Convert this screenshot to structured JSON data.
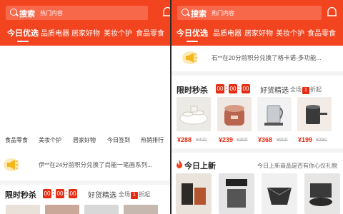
{
  "header": {
    "search_label": "搜索",
    "search_hint": "热门内容",
    "tabs": [
      "今日优选",
      "品质电器",
      "居家好物",
      "美妆个护",
      "食品零食"
    ]
  },
  "left": {
    "categories": [
      "食品零食",
      "美妆个护",
      "居家好物",
      "今日签到",
      "热销排行"
    ],
    "notice": "伊**在24分前积分兑换了尚能一笔画系列...",
    "flash_title": "限时秒杀",
    "countdown": [
      "00",
      "00",
      "00"
    ],
    "good_title": "好货精选",
    "promo_prefix": "全场",
    "promo_num": "1",
    "promo_suffix": "折起"
  },
  "right": {
    "notice": "石**在20分前积分兑换了格卡诺-多功能...",
    "flash_title": "限时秒杀",
    "countdown": [
      "00",
      "00",
      "00"
    ],
    "good_title": "好货精选",
    "promo_prefix": "全场",
    "promo_num": "1",
    "promo_suffix": "折起",
    "products": [
      {
        "price": "¥288",
        "old": "¥400"
      },
      {
        "price": "¥239",
        "old": "¥300"
      },
      {
        "price": "¥368",
        "old": "¥500"
      },
      {
        "price": "¥199",
        "old": "¥290"
      }
    ],
    "today_title": "今日上新",
    "today_sub": "今日上新商品是否有你心仪礼物"
  },
  "colors": {
    "brand": "#f2441e",
    "price": "#e52b11"
  }
}
